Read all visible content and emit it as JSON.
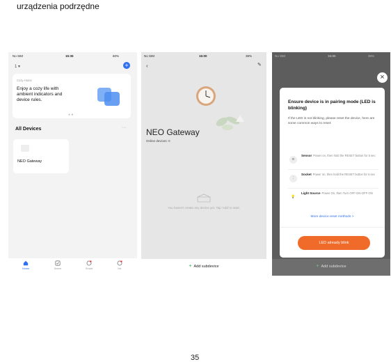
{
  "page": {
    "heading": "urządzenia podrzędne",
    "page_number": "35"
  },
  "phone1": {
    "status": {
      "carrier": "No SIM",
      "time": "15:35",
      "battery": "60%"
    },
    "home_selector": "1",
    "card": {
      "label": "Cozy Home",
      "text": "Enjoy a cozy life with ambient indicators and device rules."
    },
    "section_title": "All Devices",
    "device_name": "NEO Gateway",
    "tabs": [
      {
        "label": "Home",
        "active": true
      },
      {
        "label": "Scene",
        "active": false
      },
      {
        "label": "Smart",
        "active": false
      },
      {
        "label": "Me",
        "active": false
      }
    ]
  },
  "phone2": {
    "status": {
      "carrier": "No SIM",
      "time": "15:00",
      "battery": "38%"
    },
    "title": "NEO Gateway",
    "online": "Online devices: 0",
    "empty_text": "You haven't create any device yet. Tap 'Add' to start.",
    "add_button": "Add subdevice"
  },
  "phone3": {
    "status": {
      "carrier": "No SIM",
      "time": "15:00",
      "battery": "38%"
    },
    "dialog": {
      "title": "Ensure device is in pairing mode (LED is blinking)",
      "subtitle": "If the LED is not blinking, please reset the device, here are some common ways to reset:",
      "rows": [
        {
          "name": "Sensor",
          "text": "Power on, then hold the RESET button for 5 sec"
        },
        {
          "name": "Socket",
          "text": "Power on, then hold the RESET button for 5 sec"
        },
        {
          "name": "Light Source",
          "text": "Power On, then Turn OFF-ON-OFF-ON"
        }
      ],
      "more_link": "More device reset methods >",
      "button": "LED already blink"
    },
    "add_button": "Add subdevice"
  },
  "colors": {
    "accent": "#2f6ff0",
    "orange": "#f06a2a",
    "green": "#1aa54a"
  }
}
